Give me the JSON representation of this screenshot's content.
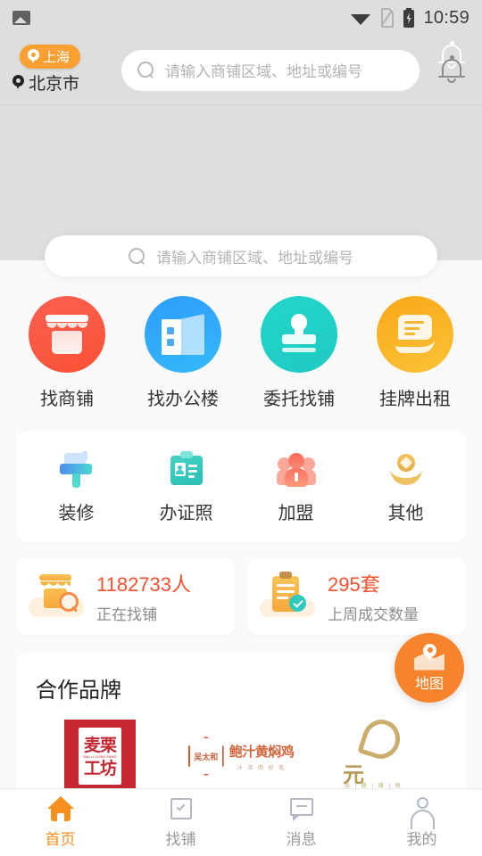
{
  "status_bar": {
    "photo_icon": "photo-icon",
    "wifi_icon": "wifi-icon",
    "sim_icon": "sim-card-icon",
    "battery_icon": "battery-charging-icon",
    "time": "10:59"
  },
  "header": {
    "city_pill": "上海",
    "current_city": "北京市",
    "search_placeholder": "请输入商铺区域、地址或编号",
    "bell_icon": "notification-bell-icon"
  },
  "banner": {
    "search_placeholder": "请输入商铺区域、地址或编号"
  },
  "main_grid": [
    {
      "label": "找商铺",
      "icon": "storefront-icon",
      "color": "#fb5a48"
    },
    {
      "label": "找办公楼",
      "icon": "office-building-icon",
      "color": "#279ef7"
    },
    {
      "label": "委托找铺",
      "icon": "stamp-icon",
      "color": "#21cfc4"
    },
    {
      "label": "挂牌出租",
      "icon": "hand-document-icon",
      "color": "#f9ae20"
    }
  ],
  "services": [
    {
      "label": "装修",
      "icon": "paint-brush-icon"
    },
    {
      "label": "办证照",
      "icon": "id-card-icon"
    },
    {
      "label": "加盟",
      "icon": "people-group-icon"
    },
    {
      "label": "其他",
      "icon": "diamond-other-icon"
    }
  ],
  "stats": [
    {
      "value": "1182733人",
      "caption": "正在找铺",
      "icon": "shop-search-icon"
    },
    {
      "value": "295套",
      "caption": "上周成交数量",
      "icon": "clipboard-check-icon"
    }
  ],
  "brands": {
    "title": "合作品牌",
    "items": [
      {
        "name": "麦栗工坊",
        "line1": "麦栗",
        "line2": "工坊",
        "sub": "MAI LI GONG FANG",
        "icon": "brand-logo-mailigongfang"
      },
      {
        "name": "吴太和 鲍汁黄焖鸡",
        "hex_text": "吴太和",
        "wordmark": "鲍汁黄焖鸡",
        "tagline": "汁 浓 肉 好 吃",
        "icon": "brand-logo-wutaihe"
      },
      {
        "name": "元",
        "cn": "元",
        "tagline": "品 | 质 | 铸 | 就",
        "icon": "brand-logo-yuan"
      }
    ]
  },
  "fab": {
    "label": "地图",
    "icon": "map-pin-icon",
    "color": "#f7832c"
  },
  "tabbar": [
    {
      "label": "首页",
      "icon": "home-icon",
      "active": true
    },
    {
      "label": "找铺",
      "icon": "shopping-bag-icon",
      "active": false
    },
    {
      "label": "消息",
      "icon": "message-icon",
      "active": false
    },
    {
      "label": "我的",
      "icon": "person-icon",
      "active": false
    }
  ],
  "theme": {
    "accent": "#f7901e",
    "accent_pill": "#faa033",
    "stat_number": "#f4522f",
    "inactive": "#9a9a9a"
  }
}
